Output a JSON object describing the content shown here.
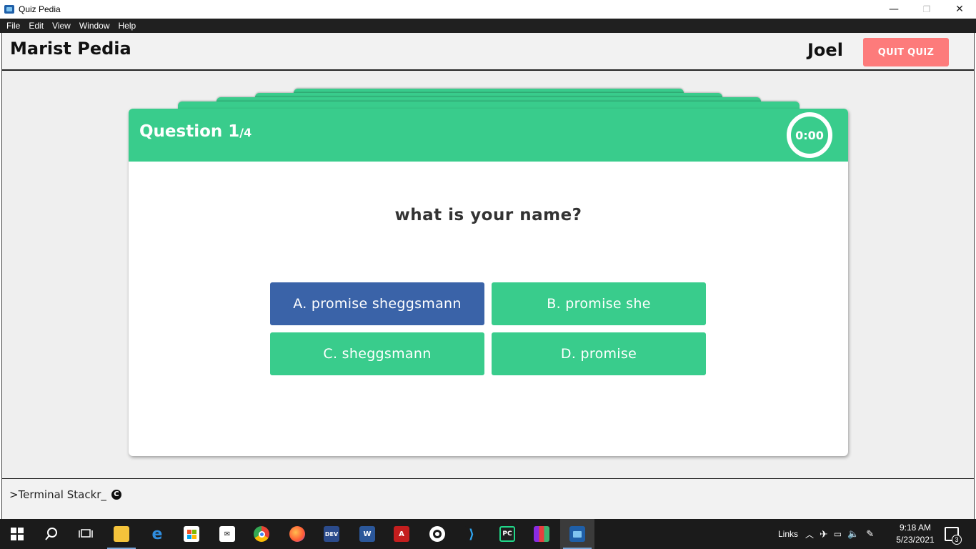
{
  "window": {
    "title": "Quiz Pedia",
    "minimize": "—",
    "restore": "❐",
    "close": "✕"
  },
  "menu": [
    "File",
    "Edit",
    "View",
    "Window",
    "Help"
  ],
  "header": {
    "brand": "Marist Pedia",
    "username": "Joel",
    "quit_label": "QUIT QUIZ"
  },
  "quiz": {
    "question_label": "Question 1",
    "question_total": "/4",
    "timer": "0:00",
    "question_text": "what is your name?",
    "answers": [
      {
        "label": "A. promise sheggsmann",
        "selected": true
      },
      {
        "label": "B. promise she",
        "selected": false
      },
      {
        "label": "C. sheggsmann",
        "selected": false
      },
      {
        "label": "D. promise",
        "selected": false
      }
    ]
  },
  "footer": {
    "text": ">Terminal Stackr_",
    "icon": "copyright-icon"
  },
  "taskbar": {
    "links_label": "Links",
    "time": "9:18 AM",
    "date": "5/23/2021",
    "notification_count": "3",
    "icons": [
      "windows-start-icon",
      "search-icon",
      "task-view-icon",
      "file-explorer-icon",
      "edge-icon",
      "store-icon",
      "mail-icon",
      "chrome-icon",
      "firefox-icon",
      "dev-icon",
      "word-icon",
      "acrobat-icon",
      "obs-icon",
      "vscode-icon",
      "pycharm-icon",
      "winrar-icon",
      "quiz-pedia-icon"
    ]
  },
  "colors": {
    "accent_green": "#39cc8c",
    "selected_blue": "#3a63a8",
    "quit_red": "#fd7b7b"
  }
}
